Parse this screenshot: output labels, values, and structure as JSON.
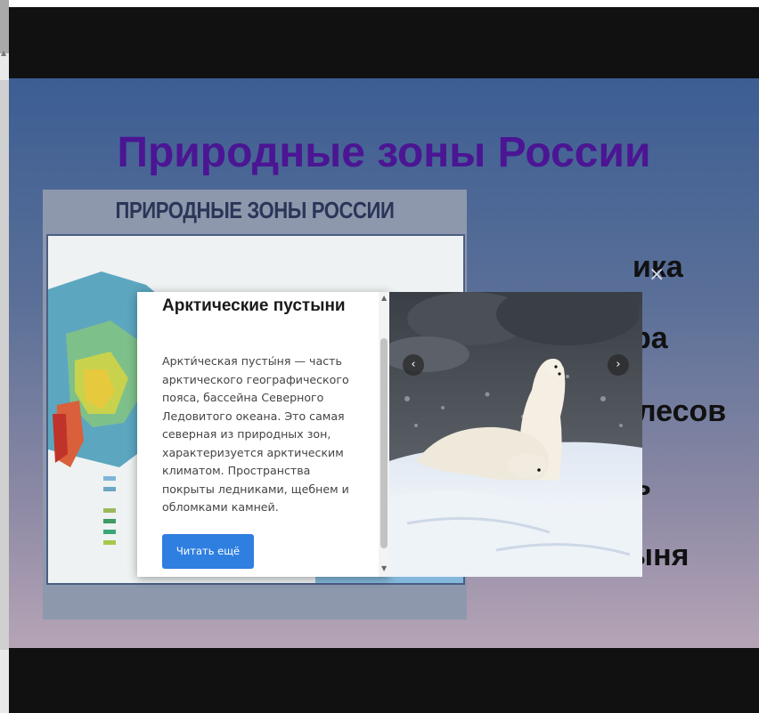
{
  "slide": {
    "title": "Природные зоны России",
    "map_heading": "ПРИРОДНЫЕ ЗОНЫ РОССИИ"
  },
  "zones": [
    {
      "label": "ика"
    },
    {
      "label": "ра"
    },
    {
      "label": "лесов"
    },
    {
      "label": "ь"
    },
    {
      "label": "Пустыня"
    }
  ],
  "popup": {
    "title": "Арктические пустыни",
    "text": "Аркти́ческая пусты́ня — часть арктического географического пояса, бассейна Северного Ледовитого океана. Это самая северная из природных зон, характеризуется арктическим климатом. Пространства покрыты ледниками, щебнем и обломками камней.",
    "button": "Читать ещё"
  },
  "controls": {
    "close": "×",
    "prev": "‹",
    "next": "›"
  },
  "colors": {
    "title": "#4b1593",
    "button": "#2f7fe0"
  }
}
